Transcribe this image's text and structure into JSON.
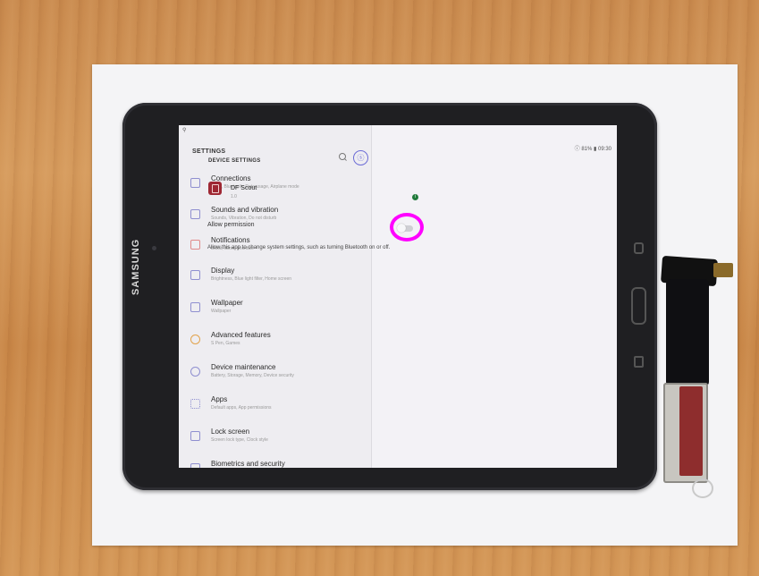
{
  "device": {
    "brand": "SAMSUNG"
  },
  "status": {
    "left_icon": "location-icon",
    "right_text": "ⓘ 81% ▮ 09:30"
  },
  "settings": {
    "title": "SETTINGS",
    "search_icon": "search-icon",
    "profile_icon": "profile-icon",
    "items": [
      {
        "label": "Connections",
        "sub": "Wi-Fi, Bluetooth, Data usage, Airplane mode",
        "icon": "connections-icon"
      },
      {
        "label": "Sounds and vibration",
        "sub": "Sounds, Vibration, Do not disturb",
        "icon": "sound-icon"
      },
      {
        "label": "Notifications",
        "sub": "Block, allow, prioritize",
        "icon": "notifications-icon"
      },
      {
        "label": "Display",
        "sub": "Brightness, Blue light filter, Home screen",
        "icon": "display-icon"
      },
      {
        "label": "Wallpaper",
        "sub": "Wallpaper",
        "icon": "wallpaper-icon"
      },
      {
        "label": "Advanced features",
        "sub": "S Pen, Games",
        "icon": "advanced-features-icon"
      },
      {
        "label": "Device maintenance",
        "sub": "Battery, Storage, Memory, Device security",
        "icon": "device-maintenance-icon"
      },
      {
        "label": "Apps",
        "sub": "Default apps, App permissions",
        "icon": "apps-icon"
      },
      {
        "label": "Lock screen",
        "sub": "Screen lock type, Clock style",
        "icon": "lock-screen-icon"
      },
      {
        "label": "Biometrics and security",
        "sub": "",
        "icon": "biometrics-icon"
      }
    ]
  },
  "device_settings": {
    "title": "DEVICE SETTINGS",
    "app_name": "DF Scout",
    "app_version": "1.0",
    "allow_label": "Allow permission",
    "allow_state": "off",
    "description": "Allow this app to change system settings, such as turning Bluetooth on or off."
  }
}
